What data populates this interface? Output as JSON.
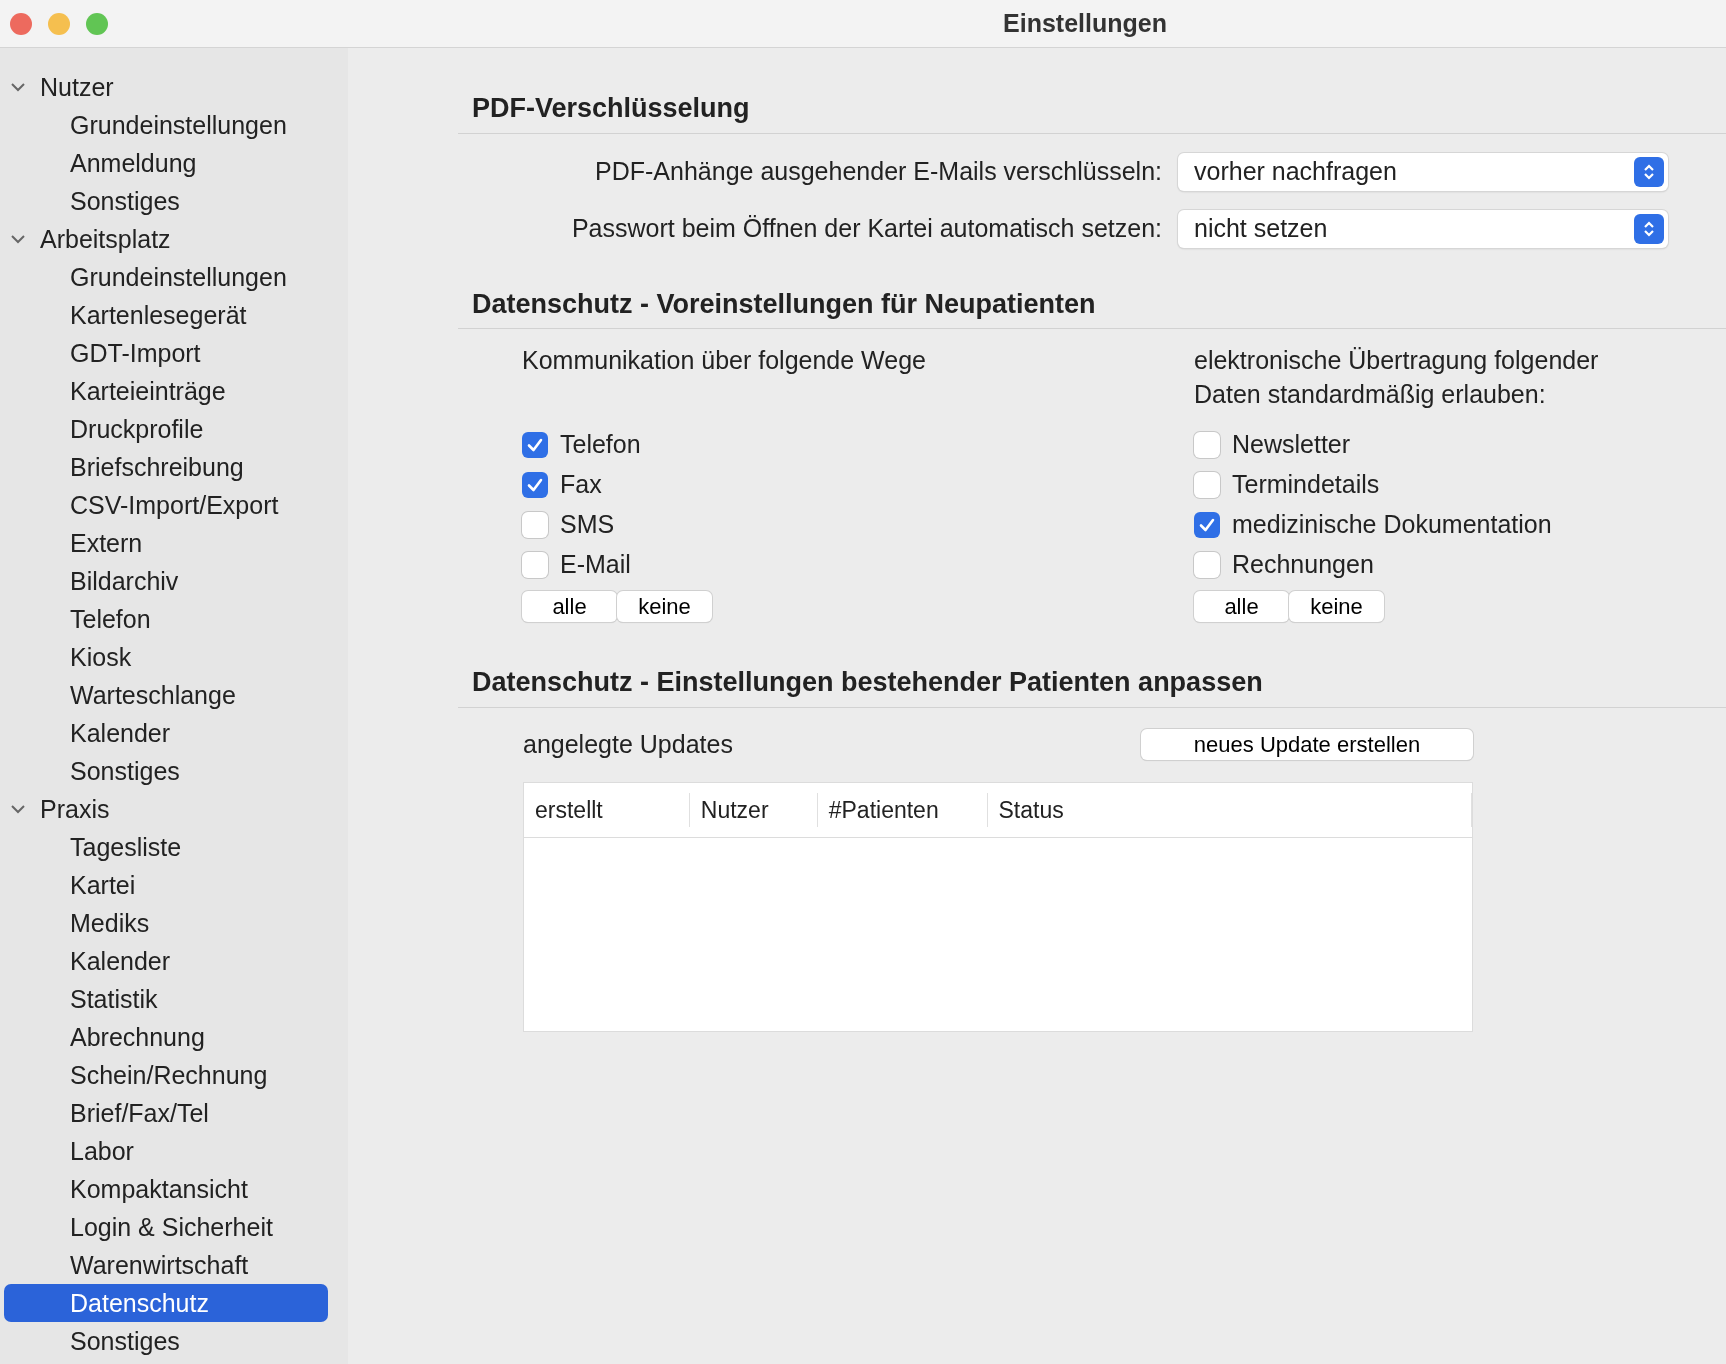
{
  "window": {
    "title": "Einstellungen"
  },
  "sidebar": {
    "groups": [
      {
        "label": "Nutzer",
        "expanded": true,
        "children": [
          {
            "label": "Grundeinstellungen",
            "selected": false
          },
          {
            "label": "Anmeldung",
            "selected": false
          },
          {
            "label": "Sonstiges",
            "selected": false
          }
        ]
      },
      {
        "label": "Arbeitsplatz",
        "expanded": true,
        "children": [
          {
            "label": "Grundeinstellungen",
            "selected": false
          },
          {
            "label": "Kartenlesegerät",
            "selected": false
          },
          {
            "label": "GDT-Import",
            "selected": false
          },
          {
            "label": "Karteieinträge",
            "selected": false
          },
          {
            "label": "Druckprofile",
            "selected": false
          },
          {
            "label": "Briefschreibung",
            "selected": false
          },
          {
            "label": "CSV-Import/Export",
            "selected": false
          },
          {
            "label": "Extern",
            "selected": false
          },
          {
            "label": "Bildarchiv",
            "selected": false
          },
          {
            "label": "Telefon",
            "selected": false
          },
          {
            "label": "Kiosk",
            "selected": false
          },
          {
            "label": "Warteschlange",
            "selected": false
          },
          {
            "label": "Kalender",
            "selected": false
          },
          {
            "label": "Sonstiges",
            "selected": false
          }
        ]
      },
      {
        "label": "Praxis",
        "expanded": true,
        "children": [
          {
            "label": "Tagesliste",
            "selected": false
          },
          {
            "label": "Kartei",
            "selected": false
          },
          {
            "label": "Mediks",
            "selected": false
          },
          {
            "label": "Kalender",
            "selected": false
          },
          {
            "label": "Statistik",
            "selected": false
          },
          {
            "label": "Abrechnung",
            "selected": false
          },
          {
            "label": "Schein/Rechnung",
            "selected": false
          },
          {
            "label": "Brief/Fax/Tel",
            "selected": false
          },
          {
            "label": "Labor",
            "selected": false
          },
          {
            "label": "Kompaktansicht",
            "selected": false
          },
          {
            "label": "Login & Sicherheit",
            "selected": false
          },
          {
            "label": "Warenwirtschaft",
            "selected": false
          },
          {
            "label": "Datenschutz",
            "selected": true
          },
          {
            "label": "Sonstiges",
            "selected": false
          }
        ]
      }
    ]
  },
  "pdf_section": {
    "title": "PDF-Verschlüsselung",
    "rows": [
      {
        "label": "PDF-Anhänge ausgehender E-Mails verschlüsseln:",
        "value": "vorher nachfragen"
      },
      {
        "label": "Passwort beim Öffnen der Kartei automatisch setzen:",
        "value": "nicht setzen"
      }
    ]
  },
  "defaults_section": {
    "title": "Datenschutz - Voreinstellungen für Neupatienten",
    "columns": [
      {
        "heading": "Kommunikation über folgende Wege",
        "options": [
          {
            "label": "Telefon",
            "checked": true
          },
          {
            "label": "Fax",
            "checked": true
          },
          {
            "label": "SMS",
            "checked": false
          },
          {
            "label": "E-Mail",
            "checked": false
          }
        ],
        "buttons": [
          "alle",
          "keine"
        ]
      },
      {
        "heading": "elektronische Übertragung folgender Daten standardmäßig erlauben:",
        "options": [
          {
            "label": "Newsletter",
            "checked": false
          },
          {
            "label": "Termindetails",
            "checked": false
          },
          {
            "label": "medizinische Dokumentation",
            "checked": true
          },
          {
            "label": "Rechnungen",
            "checked": false
          }
        ],
        "buttons": [
          "alle",
          "keine"
        ]
      }
    ]
  },
  "updates_section": {
    "title": "Datenschutz - Einstellungen bestehender Patienten anpassen",
    "label": "angelegte Updates",
    "button": "neues Update erstellen",
    "table": {
      "columns": [
        "erstellt",
        "Nutzer",
        "#Patienten",
        "Status"
      ]
    }
  }
}
